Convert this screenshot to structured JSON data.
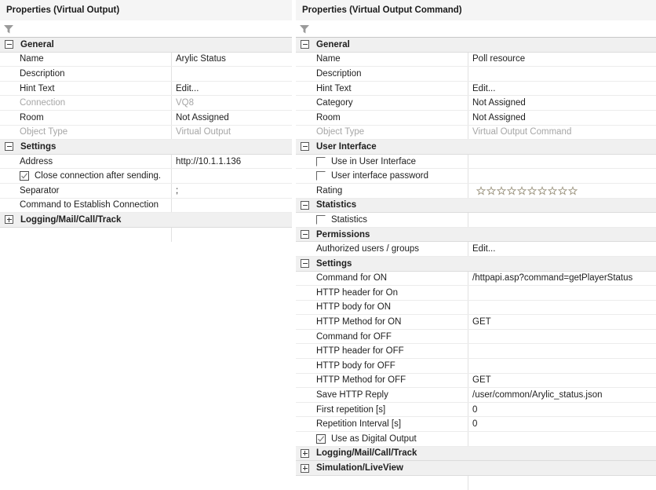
{
  "left_panel": {
    "title": "Properties (Virtual Output)",
    "filter_icon": "funnel-filter-icon",
    "sections": [
      {
        "id": "general",
        "label": "General",
        "expanded": true,
        "rows": [
          {
            "label": "Name",
            "value": "Arylic Status",
            "type": "text",
            "dim": false
          },
          {
            "label": "Description",
            "value": "",
            "type": "text",
            "dim": false
          },
          {
            "label": "Hint Text",
            "value": "Edit...",
            "type": "text",
            "dim": false
          },
          {
            "label": "Connection",
            "value": "VQ8",
            "type": "text",
            "dim": true
          },
          {
            "label": "Room",
            "value": "Not Assigned",
            "type": "text",
            "dim": false
          },
          {
            "label": "Object Type",
            "value": "Virtual Output",
            "type": "text",
            "dim": true
          }
        ]
      },
      {
        "id": "settings",
        "label": "Settings",
        "expanded": true,
        "rows": [
          {
            "label": "Address",
            "value": "http://10.1.1.136",
            "type": "text",
            "dim": false
          },
          {
            "label": "Close connection after sending.",
            "value": "",
            "type": "checkbox",
            "checked": true
          },
          {
            "label": "Separator",
            "value": ";",
            "type": "text",
            "dim": false
          },
          {
            "label": "Command to Establish Connection",
            "value": "",
            "type": "text",
            "dim": false
          }
        ]
      },
      {
        "id": "logging",
        "label": "Logging/Mail/Call/Track",
        "expanded": false,
        "rows": []
      }
    ]
  },
  "right_panel": {
    "title": "Properties (Virtual Output Command)",
    "filter_icon": "funnel-filter-icon",
    "rating_stars": 10,
    "sections": [
      {
        "id": "general",
        "label": "General",
        "expanded": true,
        "rows": [
          {
            "label": "Name",
            "value": "Poll resource",
            "type": "text",
            "dim": false
          },
          {
            "label": "Description",
            "value": "",
            "type": "text",
            "dim": false
          },
          {
            "label": "Hint Text",
            "value": "Edit...",
            "type": "text",
            "dim": false
          },
          {
            "label": "Category",
            "value": "Not Assigned",
            "type": "text",
            "dim": false
          },
          {
            "label": "Room",
            "value": "Not Assigned",
            "type": "text",
            "dim": false
          },
          {
            "label": "Object Type",
            "value": "Virtual Output Command",
            "type": "text",
            "dim": true
          }
        ]
      },
      {
        "id": "user-interface",
        "label": "User Interface",
        "expanded": true,
        "rows": [
          {
            "label": "Use in User Interface",
            "value": "",
            "type": "checkbox",
            "checked": false
          },
          {
            "label": "User interface password",
            "value": "",
            "type": "checkbox",
            "checked": false
          },
          {
            "label": "Rating",
            "value": "",
            "type": "stars"
          }
        ]
      },
      {
        "id": "statistics",
        "label": "Statistics",
        "expanded": true,
        "rows": [
          {
            "label": "Statistics",
            "value": "",
            "type": "checkbox",
            "checked": false
          }
        ]
      },
      {
        "id": "permissions",
        "label": "Permissions",
        "expanded": true,
        "rows": [
          {
            "label": "Authorized users / groups",
            "value": "Edit...",
            "type": "text",
            "dim": false
          }
        ]
      },
      {
        "id": "settings",
        "label": "Settings",
        "expanded": true,
        "rows": [
          {
            "label": "Command for ON",
            "value": "/httpapi.asp?command=getPlayerStatus",
            "type": "text",
            "dim": false
          },
          {
            "label": "HTTP header for On",
            "value": "",
            "type": "text",
            "dim": false
          },
          {
            "label": "HTTP body for ON",
            "value": "",
            "type": "text",
            "dim": false
          },
          {
            "label": "HTTP Method for ON",
            "value": "GET",
            "type": "text",
            "dim": false
          },
          {
            "label": "Command for OFF",
            "value": "",
            "type": "text",
            "dim": false
          },
          {
            "label": "HTTP header for OFF",
            "value": "",
            "type": "text",
            "dim": false
          },
          {
            "label": "HTTP body for OFF",
            "value": "",
            "type": "text",
            "dim": false
          },
          {
            "label": "HTTP Method for OFF",
            "value": "GET",
            "type": "text",
            "dim": false
          },
          {
            "label": "Save HTTP Reply",
            "value": "/user/common/Arylic_status.json",
            "type": "text",
            "dim": false
          },
          {
            "label": "First repetition [s]",
            "value": "0",
            "type": "text",
            "dim": false
          },
          {
            "label": "Repetition Interval [s]",
            "value": "0",
            "type": "text",
            "dim": false
          },
          {
            "label": "Use as Digital Output",
            "value": "",
            "type": "checkbox",
            "checked": true
          }
        ]
      },
      {
        "id": "logging",
        "label": "Logging/Mail/Call/Track",
        "expanded": false,
        "rows": []
      },
      {
        "id": "simulation",
        "label": "Simulation/LiveView",
        "expanded": false,
        "rows": []
      }
    ]
  },
  "colors": {
    "section_header_bg": "#f0f0f0",
    "titlebar_bg": "#f5f5f5",
    "row_border": "#ececec",
    "dim_text": "#a6a6a6",
    "text": "#1e1e1e",
    "star_outline": "#a09884"
  }
}
